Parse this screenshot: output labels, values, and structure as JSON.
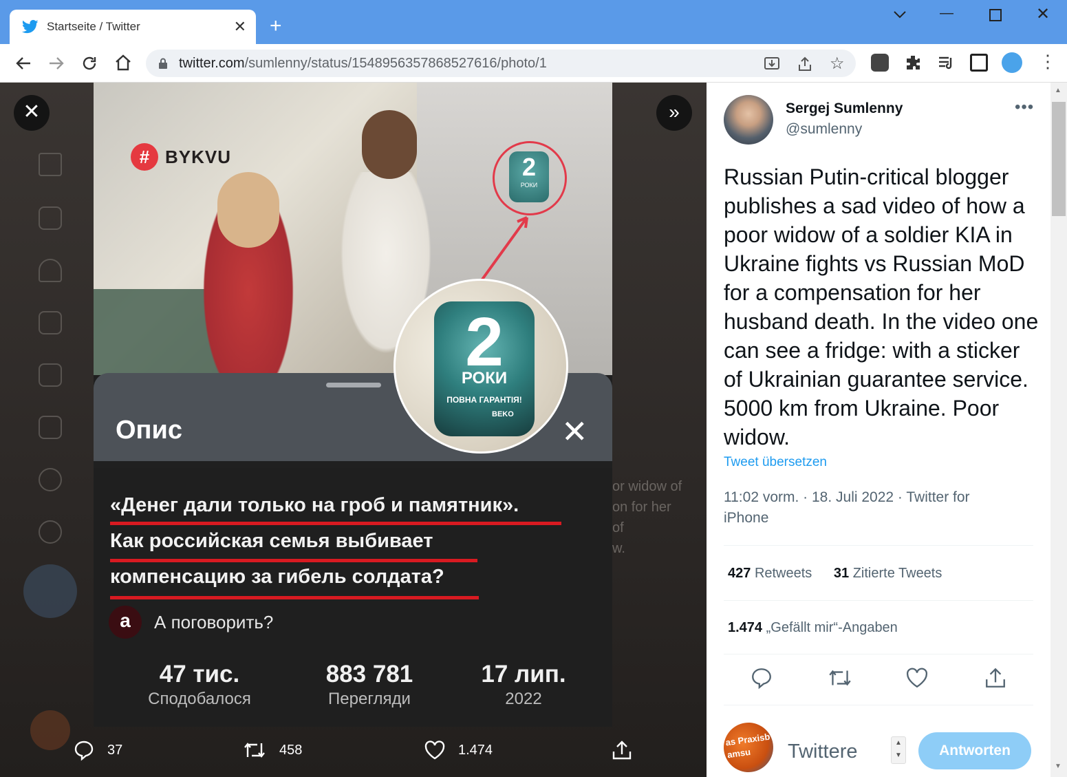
{
  "browser": {
    "tab_title": "Startseite / Twitter",
    "url_host": "twitter.com",
    "url_path": "/sumlenny/status/1548956357868527616/photo/1"
  },
  "media": {
    "badge": "BYKVU",
    "sticker_number": "2",
    "sticker_label": "РОКИ",
    "sticker_guarantee": "ПОВНА ГАРАНТІЯ!",
    "sticker_brand": "BEKO",
    "sheet_title": "Опис",
    "headline_lines": [
      "«Денег дали только на гроб и памятник».",
      "Как российская семья выбивает",
      "компенсацию за гибель солдата?"
    ],
    "channel_avatar": "а",
    "channel_name": "А поговорить?",
    "stats": [
      {
        "value": "47 тис.",
        "label": "Сподобалося"
      },
      {
        "value": "883 781",
        "label": "Перегляди"
      },
      {
        "value": "17 лип.",
        "label": "2022"
      }
    ],
    "bg_peek_text": [
      "or widow of",
      "on for her",
      "of",
      "w."
    ]
  },
  "viewer_actions": {
    "replies": "37",
    "retweets": "458",
    "likes": "1.474"
  },
  "tweet": {
    "display_name": "Sergej Sumlenny",
    "handle": "@sumlenny",
    "text": "Russian Putin-critical blogger publishes a sad video of how a poor widow of a soldier KIA in Ukraine fights vs Russian MoD for a compensation for her husband death. In the video one can see a fridge: with a sticker of Ukrainian guarantee service. 5000 km from Ukraine. Poor widow.",
    "translate": "Tweet übersetzen",
    "meta": "11:02 vorm. · 18. Juli 2022 · Twitter for iPhone",
    "retweets_count": "427",
    "retweets_label": "Retweets",
    "quotes_count": "31",
    "quotes_label": "Zitierte Tweets",
    "likes_count": "1.474",
    "likes_label": "„Gefällt mir“-Angaben",
    "reply_placeholder": "Twittere",
    "reply_button": "Antworten",
    "reply_avatar_text": "as Praxisb\namsu"
  },
  "colors": {
    "twitter_blue": "#1d9bf0",
    "tab_bar": "#5a9ae8",
    "accent_red": "#d81a21"
  }
}
